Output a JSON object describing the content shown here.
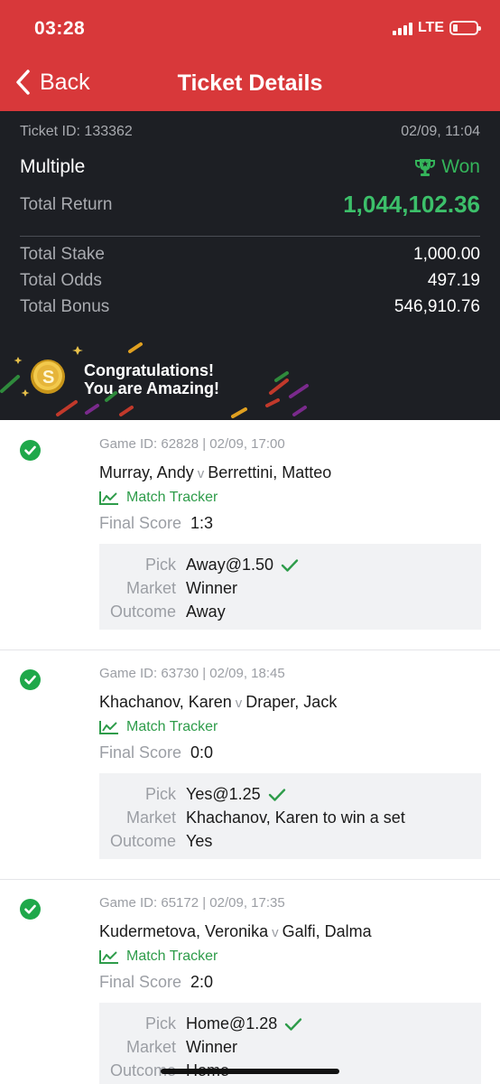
{
  "status": {
    "time": "03:28",
    "network": "LTE"
  },
  "nav": {
    "back_label": "Back",
    "title": "Ticket Details"
  },
  "summary": {
    "ticket_id": "Ticket ID: 133362",
    "datetime": "02/09, 11:04",
    "bet_type": "Multiple",
    "status_label": "Won",
    "total_return_label": "Total Return",
    "total_return": "1,044,102.36",
    "total_stake_label": "Total Stake",
    "total_stake": "1,000.00",
    "total_odds_label": "Total Odds",
    "total_odds": "497.19",
    "total_bonus_label": "Total Bonus",
    "total_bonus": "546,910.76",
    "banner_line1": "Congratulations!",
    "banner_line2": "You are Amazing!"
  },
  "labels": {
    "versus": "v",
    "match_tracker": "Match Tracker",
    "final_score": "Final Score",
    "pick": "Pick",
    "market": "Market",
    "outcome": "Outcome"
  },
  "bets": [
    {
      "meta": "Game ID: 62828 |  02/09, 17:00",
      "home": "Murray, Andy",
      "away": "Berrettini, Matteo",
      "score": "1:3",
      "pick": "Away@1.50",
      "market": "Winner",
      "outcome": "Away"
    },
    {
      "meta": "Game ID: 63730 |  02/09, 18:45",
      "home": "Khachanov, Karen",
      "away": "Draper, Jack",
      "score": "0:0",
      "pick": "Yes@1.25",
      "market": "Khachanov, Karen to win a set",
      "outcome": "Yes"
    },
    {
      "meta": "Game ID: 65172 |  02/09, 17:35",
      "home": "Kudermetova, Veronika",
      "away": "Galfi, Dalma",
      "score": "2:0",
      "pick": "Home@1.28",
      "market": "Winner",
      "outcome": "Home"
    }
  ],
  "colors": {
    "header": "#d8383a",
    "summary_bg": "#1d1f24",
    "won_green": "#34b45a",
    "return_green": "#3cc06a",
    "check_green": "#1fa84a"
  }
}
